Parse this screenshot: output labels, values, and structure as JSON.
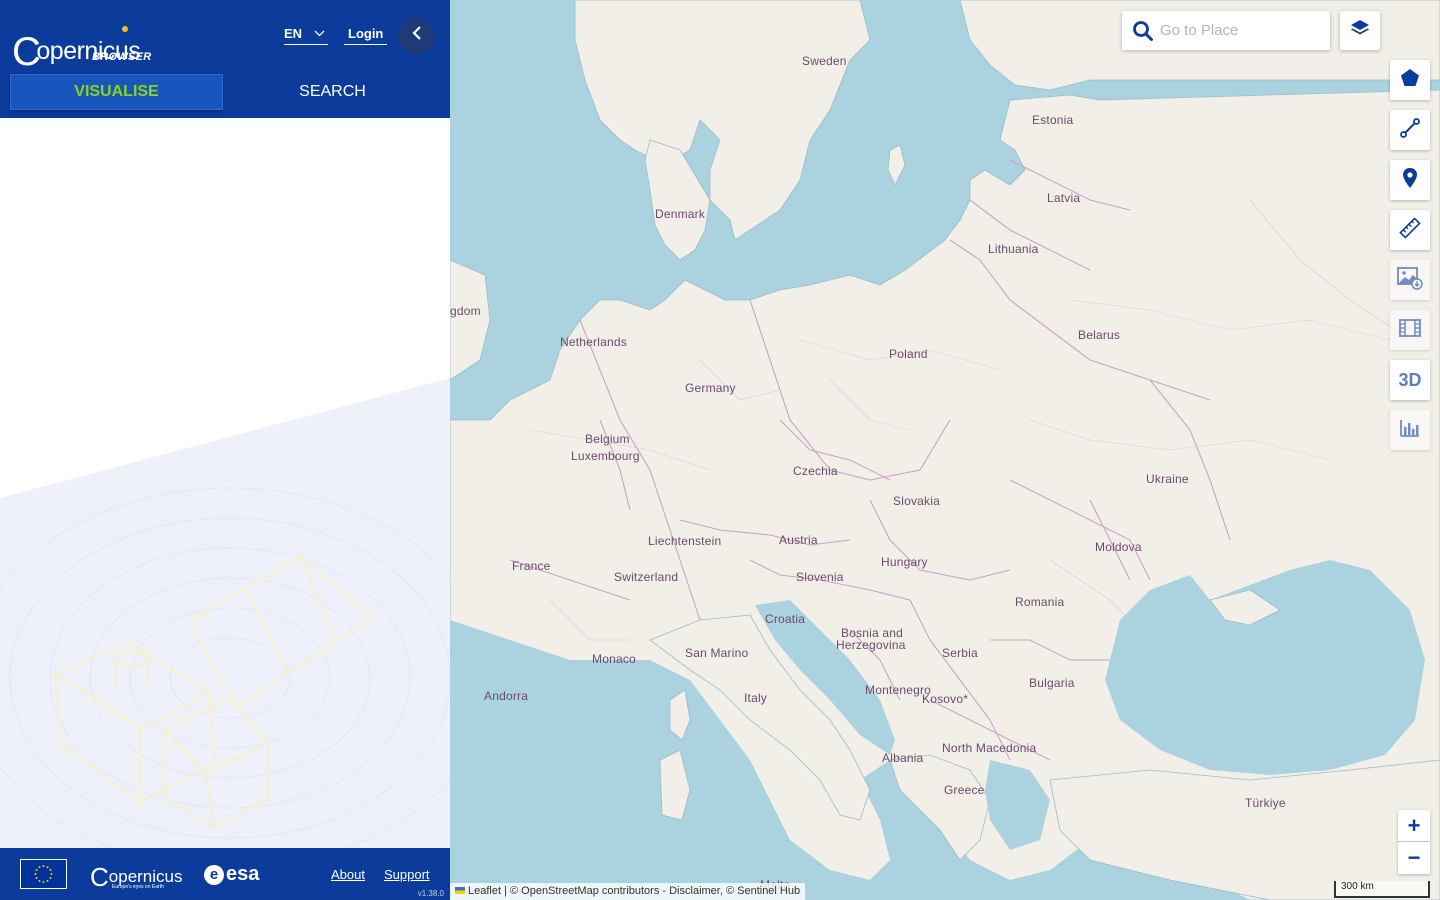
{
  "header": {
    "logo_text": "opernicus",
    "logo_sub": "BROWSER",
    "language": "EN",
    "login": "Login"
  },
  "tabs": [
    {
      "label": "VISUALISE",
      "active": true
    },
    {
      "label": "SEARCH",
      "active": false
    }
  ],
  "footer": {
    "copernicus": "opernicus",
    "copernicus_tagline": "Europe's eyes on Earth",
    "esa": "esa",
    "about": "About",
    "support": "Support",
    "version": "v1.38.0"
  },
  "map": {
    "search_placeholder": "Go to Place",
    "labels": {
      "sweden": "Sweden",
      "estonia": "Estonia",
      "latvia": "Latvia",
      "denmark": "Denmark",
      "lithuania": "Lithuania",
      "kingdom": "gdom",
      "netherlands": "Netherlands",
      "belarus": "Belarus",
      "poland": "Poland",
      "germany": "Germany",
      "belgium": "Belgium",
      "luxembourg": "Luxembourg",
      "czechia": "Czechia",
      "ukraine": "Ukraine",
      "slovakia": "Slovakia",
      "liechtenstein": "Liechtenstein",
      "austria": "Austria",
      "moldova": "Moldova",
      "france": "France",
      "switzerland": "Switzerland",
      "slovenia": "Slovenia",
      "hungary": "Hungary",
      "romania": "Romania",
      "croatia": "Croatia",
      "bosnia1": "Bosnia and",
      "bosnia2": "Herzegovina",
      "monaco": "Monaco",
      "san_marino": "San Marino",
      "serbia": "Serbia",
      "andorra": "Andorra",
      "italy": "Italy",
      "montenegro": "Montenegro",
      "kosovo": "Kosovo*",
      "bulgaria": "Bulgaria",
      "north_macedonia": "North Macedonia",
      "albania": "Albania",
      "greece": "Greece",
      "turkiye": "Türkiye",
      "malta": "Malta"
    },
    "attribution": "Leaflet | © OpenStreetMap contributors - Disclaimer, © Sentinel Hub",
    "scale": "300 km",
    "zoom_in": "+",
    "zoom_out": "−",
    "tool_3d": "3D"
  },
  "colors": {
    "brand_blue": "#0b3c9c",
    "active_tab_text": "#8cd11c",
    "sea": "#aad3df",
    "land": "#f2efe9",
    "border": "#c9a3c9"
  }
}
